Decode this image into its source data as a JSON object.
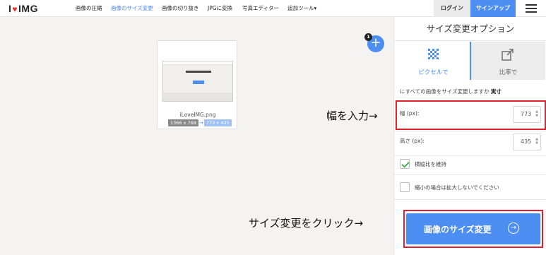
{
  "nav": {
    "logo_left": "I",
    "logo_right": "IMG",
    "items": [
      "画像の圧縮",
      "画像のサイズ変更",
      "画像の切り抜き",
      "JPGに変換",
      "写真エディター",
      "追加ツール▾"
    ],
    "login": "ログイン",
    "signup": "サインアップ"
  },
  "file": {
    "name": "iLoveIMG.png",
    "original_size": "1366 x 768",
    "arrow": "→",
    "new_size": "773 x 435"
  },
  "add": {
    "badge": "1",
    "plus": "+"
  },
  "panel": {
    "title": "サイズ変更オプション",
    "tabs": [
      {
        "label": "ピクセルで",
        "icon": "pixels-icon",
        "active": true
      },
      {
        "label": "比率で",
        "icon": "percentage-icon",
        "active": false
      }
    ],
    "apply_text": "にすべての画像をサイズ変更しますか",
    "apply_value": "実寸",
    "width_label": "幅 (px):",
    "width_value": "773",
    "height_label": "高さ (px):",
    "height_value": "435",
    "keep_ratio_label": "横縦比を維持",
    "keep_ratio_checked": true,
    "no_enlarge_label": "縮小の場合は拡大しないでください",
    "no_enlarge_checked": false,
    "resize_button": "画像のサイズ変更",
    "accent_color": "#4d8ef3"
  },
  "annotations": {
    "width_note": "幅を入力→",
    "button_note": "サイズ変更をクリック→",
    "highlight_color": "#e0202a"
  }
}
